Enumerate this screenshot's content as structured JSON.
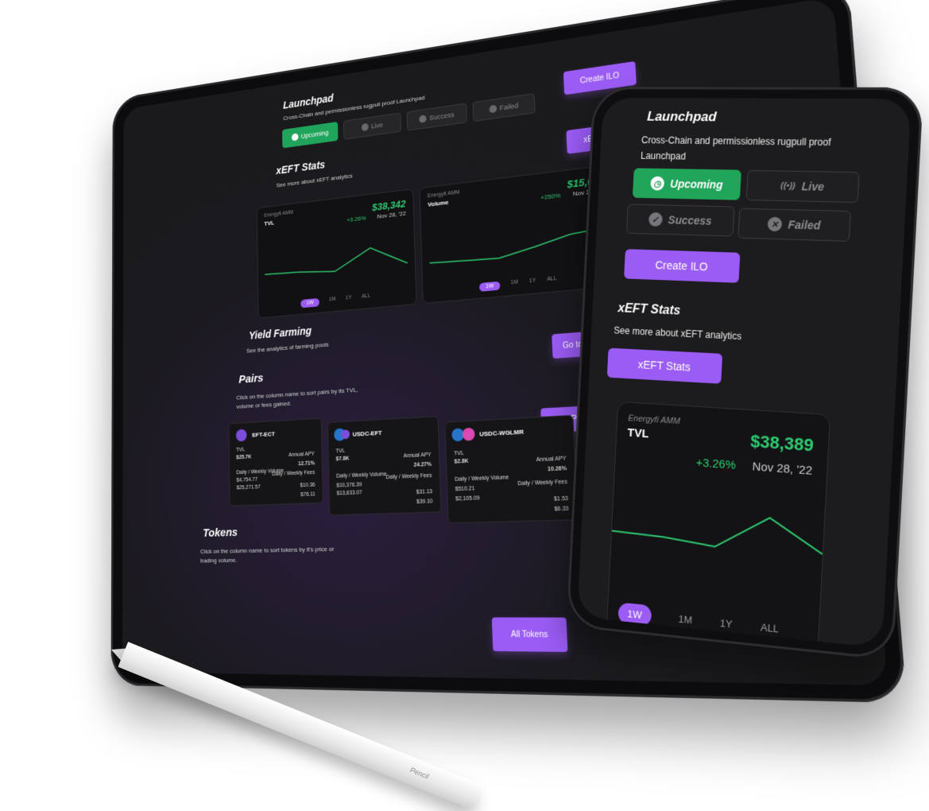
{
  "colors": {
    "accent": "#9b5cf6",
    "success": "#21a55a",
    "positive": "#2ecc71",
    "background": "#1c1c1e"
  },
  "tablet": {
    "launchpad": {
      "title": "Launchpad",
      "subtitle": "Cross-Chain and permissionless rugpull proof Launchpad",
      "tabs": [
        {
          "label": "Upcoming",
          "icon": "clock-icon",
          "active": true
        },
        {
          "label": "Live",
          "icon": "broadcast-icon",
          "active": false
        },
        {
          "label": "Success",
          "icon": "check-circle-icon",
          "active": false
        },
        {
          "label": "Failed",
          "icon": "x-circle-icon",
          "active": false
        }
      ],
      "create_button": "Create ILO"
    },
    "stats": {
      "title": "xEFT Stats",
      "subtitle": "See more about xEFT analytics",
      "button": "xEFT Stats",
      "charts": [
        {
          "source": "Energyfi AMM",
          "label": "TVL",
          "value": "$38,342",
          "change": "+3.26%",
          "date": "Nov 28, '22",
          "ranges": [
            "1W",
            "1M",
            "1Y",
            "ALL"
          ],
          "active_range": "1W",
          "points": [
            40,
            38,
            32,
            70,
            34
          ]
        },
        {
          "source": "Energyfi AMM",
          "label": "Volume",
          "value": "$15,677",
          "change": "+250%",
          "date": "Nov 28, '22",
          "ranges": [
            "1W",
            "1M",
            "1Y",
            "ALL"
          ],
          "active_range": "1W",
          "points": [
            30,
            28,
            26,
            40,
            56,
            62
          ]
        }
      ]
    },
    "yield": {
      "title": "Yield Farming",
      "subtitle": "See the analytics of farming pools",
      "button": "Go to Farming"
    },
    "pairs": {
      "title": "Pairs",
      "subtitle_line1": "Click on the column name to sort pairs by its TVL,",
      "subtitle_line2": "volume or fees gained.",
      "button": "All Pairs",
      "cards": [
        {
          "name": "EFT-ECT",
          "tvl_label": "TVL",
          "tvl": "$25.7K",
          "apy_label": "Annual APY",
          "apy": "12.71%",
          "vol_label": "Daily / Weekly Volume",
          "vol_daily": "$4,754.77",
          "vol_weekly": "$25,271.57",
          "fees_label": "Daily / Weekly Fees",
          "fees_daily": "$10.36",
          "fees_weekly": "$76.11"
        },
        {
          "name": "USDC-EFT",
          "tvl_label": "TVL",
          "tvl": "$7.8K",
          "apy_label": "Annual APY",
          "apy": "24.27%",
          "vol_label": "Daily / Weekly Volume",
          "vol_daily": "$10,376.39",
          "vol_weekly": "$13,633.07",
          "fees_label": "Daily / Weekly Fees",
          "fees_daily": "$31.13",
          "fees_weekly": "$39.10"
        },
        {
          "name": "USDC-WGLMR",
          "tvl_label": "TVL",
          "tvl": "$2.8K",
          "apy_label": "Annual APY",
          "apy": "10.26%",
          "vol_label": "Daily / Weekly Volume",
          "vol_daily": "$510.21",
          "vol_weekly": "$2,105.09",
          "fees_label": "Daily / Weekly Fees",
          "fees_daily": "$1.53",
          "fees_weekly": "$6.33"
        }
      ]
    },
    "tokens": {
      "title": "Tokens",
      "subtitle_line1": "Click on the column name to sort tokens by it's price or",
      "subtitle_line2": "trading volume.",
      "button": "All Tokens"
    }
  },
  "phone": {
    "launchpad": {
      "title": "Launchpad",
      "subtitle": "Cross-Chain and permissionless rugpull proof Launchpad",
      "tabs": [
        {
          "label": "Upcoming",
          "icon": "clock-icon",
          "glyph": "◷",
          "active": true
        },
        {
          "label": "Live",
          "icon": "broadcast-icon",
          "glyph": "((•))",
          "active": false
        },
        {
          "label": "Success",
          "icon": "check-circle-icon",
          "glyph": "✓",
          "active": false
        },
        {
          "label": "Failed",
          "icon": "x-circle-icon",
          "glyph": "✕",
          "active": false
        }
      ],
      "create_button": "Create ILO"
    },
    "stats": {
      "title": "xEFT Stats",
      "subtitle": "See more about xEFT analytics",
      "button": "xEFT Stats",
      "chart": {
        "source": "Energyfi AMM",
        "label": "TVL",
        "value": "$38,389",
        "change": "+3.26%",
        "date": "Nov 28, '22",
        "ranges": [
          "1W",
          "1M",
          "1Y",
          "ALL"
        ],
        "active_range": "1W",
        "points": [
          40,
          38,
          32,
          70,
          34
        ]
      }
    }
  },
  "pencil": {
    "label": "Pencil"
  }
}
